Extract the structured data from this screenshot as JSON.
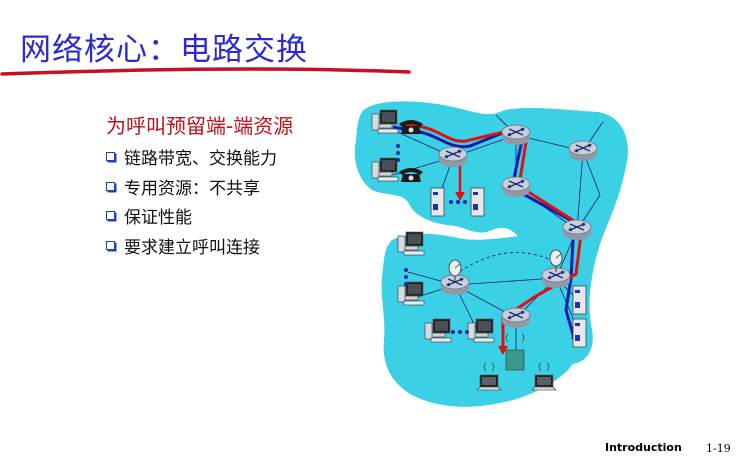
{
  "slide": {
    "title": "网络核心：电路交换",
    "subtitle": "为呼叫预留端-端资源",
    "bullets": [
      "链路带宽、交换能力",
      "专用资源：不共享",
      "保证性能",
      "要求建立呼叫连接"
    ]
  },
  "footer": {
    "label": "Introduction",
    "page": "1-19"
  },
  "colors": {
    "title": "#2b2bd0",
    "subtitle": "#c0101a",
    "underline": "#c81020",
    "network_bg": "#39d0e6",
    "circuit_red": "#e01010",
    "circuit_blue": "#1a1aa8"
  },
  "icons": [
    "router-icon",
    "telephone-icon",
    "computer-icon",
    "server-icon",
    "satellite-dish-icon",
    "laptop-icon",
    "wireless-base-station-icon"
  ]
}
